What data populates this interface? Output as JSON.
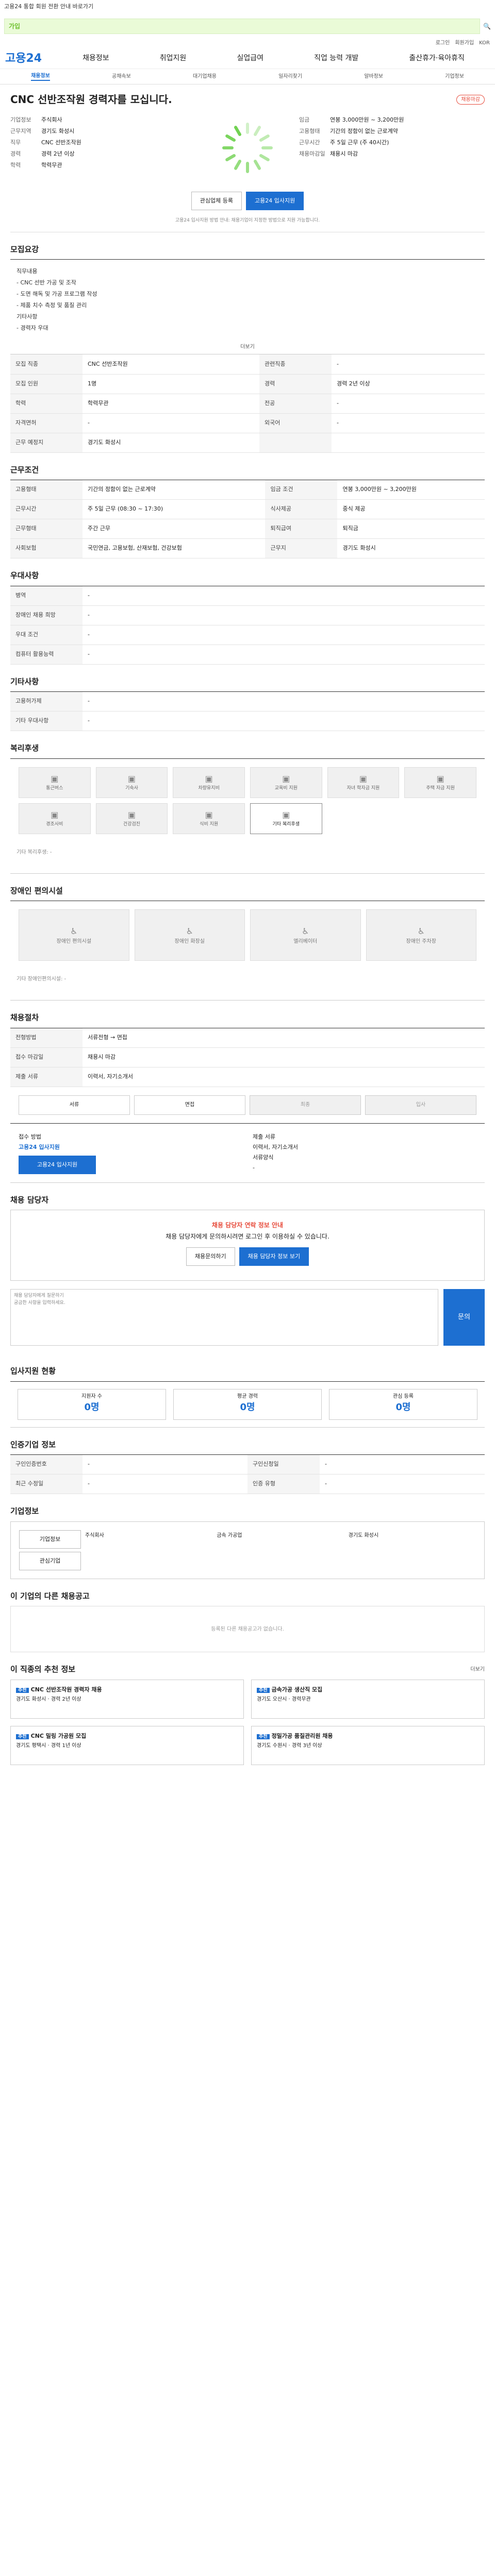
{
  "top": {
    "notice": "고용24 통합 회원 전환 안내 바로가기"
  },
  "search": {
    "text": "가입",
    "placeholder": "검색어를 입력하세요"
  },
  "mini": {
    "login": "로그인",
    "join": "회원가입",
    "lang": "KOR"
  },
  "logo": "고용24",
  "gnb": [
    "채용정보",
    "취업지원",
    "실업급여",
    "직업 능력 개발",
    "출산휴가·육아휴직"
  ],
  "subnav": [
    "채용정보",
    "공채속보",
    "대기업채용",
    "일자리찾기",
    "알바정보",
    "기업정보"
  ],
  "job": {
    "title": "CNC 선반조작원 경력자를 모십니다.",
    "status": "채용마감",
    "company_label": "기업정보",
    "company": "주식회사",
    "location_label": "근무지역",
    "location": "경기도 화성시",
    "duty_label": "직무",
    "duty": "CNC 선반조작원",
    "career_label": "경력",
    "career": "경력 2년 이상",
    "edu_label": "학력",
    "edu": "학력무관",
    "pay_label": "임금",
    "pay": "연봉 3,000만원 ~ 3,200만원",
    "form_label": "고용형태",
    "form": "기간의 정함이 없는 근로계약",
    "hours_label": "근무시간",
    "hours": "주 5일 근무 (주 40시간)",
    "deadline_label": "채용마감일",
    "deadline": "채용시 마감"
  },
  "actions": {
    "scrap": "관심업체 등록",
    "apply": "고용24 입사지원"
  },
  "note": "고용24 입사지원 방법 안내: 채용기업이 지정한 방법으로 지원 가능합니다.",
  "sections": {
    "recruit": "모집요강",
    "condition": "근무조건",
    "welfare": "우대사항",
    "other": "기타사항",
    "facility": "복리후생",
    "disabled": "장애인 편의시설",
    "process": "채용절차",
    "contact": "채용 담당자",
    "stats": "입사지원 현황",
    "info": "인증기업 정보",
    "company": "기업정보",
    "other_jobs": "이 기업의 다른 채용공고",
    "recommend": "이 직종의 추천 정보"
  },
  "recruit": {
    "lines": [
      "직무내용",
      "- CNC 선반 가공 및 조작",
      "- 도면 해독 및 가공 프로그램 작성",
      "- 제품 치수 측정 및 품질 관리",
      "기타사항",
      "- 경력자 우대"
    ],
    "more": "더보기"
  },
  "recruit_table": [
    [
      "모집 직종",
      "CNC 선반조작원",
      "관련직종",
      "-"
    ],
    [
      "모집 인원",
      "1명",
      "경력",
      "경력 2년 이상"
    ],
    [
      "학력",
      "학력무관",
      "전공",
      "-"
    ],
    [
      "자격면허",
      "-",
      "외국어",
      "-"
    ],
    [
      "근무 예정지",
      "경기도 화성시",
      "",
      ""
    ]
  ],
  "condition_table": [
    [
      "고용형태",
      "기간의 정함이 없는 근로계약",
      "임금 조건",
      "연봉 3,000만원 ~ 3,200만원"
    ],
    [
      "근무시간",
      "주 5일 근무 (08:30 ~ 17:30)",
      "식사제공",
      "중식 제공"
    ],
    [
      "근무형태",
      "주간 근무",
      "퇴직급여",
      "퇴직금"
    ],
    [
      "사회보험",
      "국민연금, 고용보험, 산재보험, 건강보험",
      "근무지",
      "경기도 화성시"
    ]
  ],
  "welfare_table": [
    [
      "병역",
      "-"
    ],
    [
      "장애인 채용 희망",
      "-"
    ],
    [
      "우대 조건",
      "-"
    ],
    [
      "컴퓨터 활용능력",
      "-"
    ]
  ],
  "other_table": [
    [
      "고용허가제",
      "-"
    ],
    [
      "기타 우대사항",
      "-"
    ]
  ],
  "facility": [
    "통근버스",
    "기숙사",
    "차량유지비",
    "교육비 지원",
    "자녀 학자금 지원",
    "주택 자금 지원",
    "경조사비",
    "건강검진",
    "식비 지원",
    "기타 복리후생"
  ],
  "facility_on": [
    9
  ],
  "facility_extra": "기타 복리후생: -",
  "disabled": [
    "장애인 편의시설",
    "장애인 화장실",
    "엘리베이터",
    "장애인 주차장"
  ],
  "disabled_extra": "기타 장애인편의시설: -",
  "process_table": [
    [
      "전형방법",
      "서류전형 → 면접"
    ],
    [
      "접수 마감일",
      "채용시 마감"
    ],
    [
      "제출 서류",
      "이력서, 자기소개서"
    ]
  ],
  "steps": [
    "서류",
    "면접",
    "최종",
    "입사"
  ],
  "apply": {
    "method_label": "접수 방법",
    "method": "고용24 입사지원",
    "docs_label": "제출 서류",
    "docs": "이력서, 자기소개서",
    "btn": "고용24 입사지원",
    "form_label": "서류양식",
    "form": "-"
  },
  "contact": {
    "warn": "채용 담당자 연락 정보 안내",
    "text": "채용 담당자에게 문의하시려면 로그인 후 이용하실 수 있습니다.",
    "btn1": "채용문의하기",
    "btn2": "채용 담당자 정보 보기"
  },
  "qna": {
    "label": "채용 담당자에게 질문하기",
    "placeholder": "궁금한 사항을 입력하세요.",
    "btn": "문의"
  },
  "stats": [
    {
      "label": "지원자 수",
      "value": "0명"
    },
    {
      "label": "평균 경력",
      "value": "0명"
    },
    {
      "label": "관심 등록",
      "value": "0명"
    }
  ],
  "info_table": [
    [
      "구인인증번호",
      "-",
      "구인신청일",
      "-"
    ],
    [
      "최근 수정일",
      "-",
      "인증 유형",
      "-"
    ]
  ],
  "company_info": {
    "name": "주식회사",
    "industry": "금속 가공업",
    "employees": "-",
    "address": "경기도 화성시",
    "btn1": "기업정보",
    "btn2": "관심기업"
  },
  "other_jobs": {
    "empty": "등록된 다른 채용공고가 없습니다."
  },
  "recommend": [
    {
      "tag": "추천",
      "title": "CNC 선반조작원 경력자 채용",
      "desc": "경기도 화성시 · 경력 2년 이상"
    },
    {
      "tag": "추천",
      "title": "금속가공 생산직 모집",
      "desc": "경기도 오산시 · 경력무관"
    },
    {
      "tag": "추천",
      "title": "CNC 밀링 가공원 모집",
      "desc": "경기도 평택시 · 경력 1년 이상"
    },
    {
      "tag": "추천",
      "title": "정밀가공 품질관리원 채용",
      "desc": "경기도 수원시 · 경력 3년 이상"
    }
  ],
  "more": "더보기",
  "colors": {
    "accent": "#1d6fd1",
    "green": "#6bd04b",
    "danger": "#e74c3c"
  }
}
